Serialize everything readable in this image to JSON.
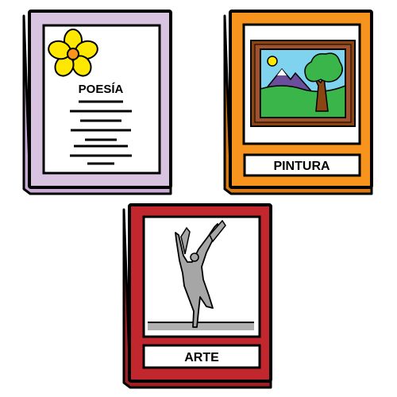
{
  "books": [
    {
      "id": "poesia",
      "title": "POESÍA",
      "cover_color": "#d8c4e0",
      "icon": "flower-icon"
    },
    {
      "id": "pintura",
      "title": "PINTURA",
      "cover_color": "#f7941d",
      "icon": "framed-landscape-painting-icon"
    },
    {
      "id": "arte",
      "title": "ARTE",
      "cover_color": "#c1272d",
      "icon": "dancer-sculpture-icon"
    }
  ]
}
